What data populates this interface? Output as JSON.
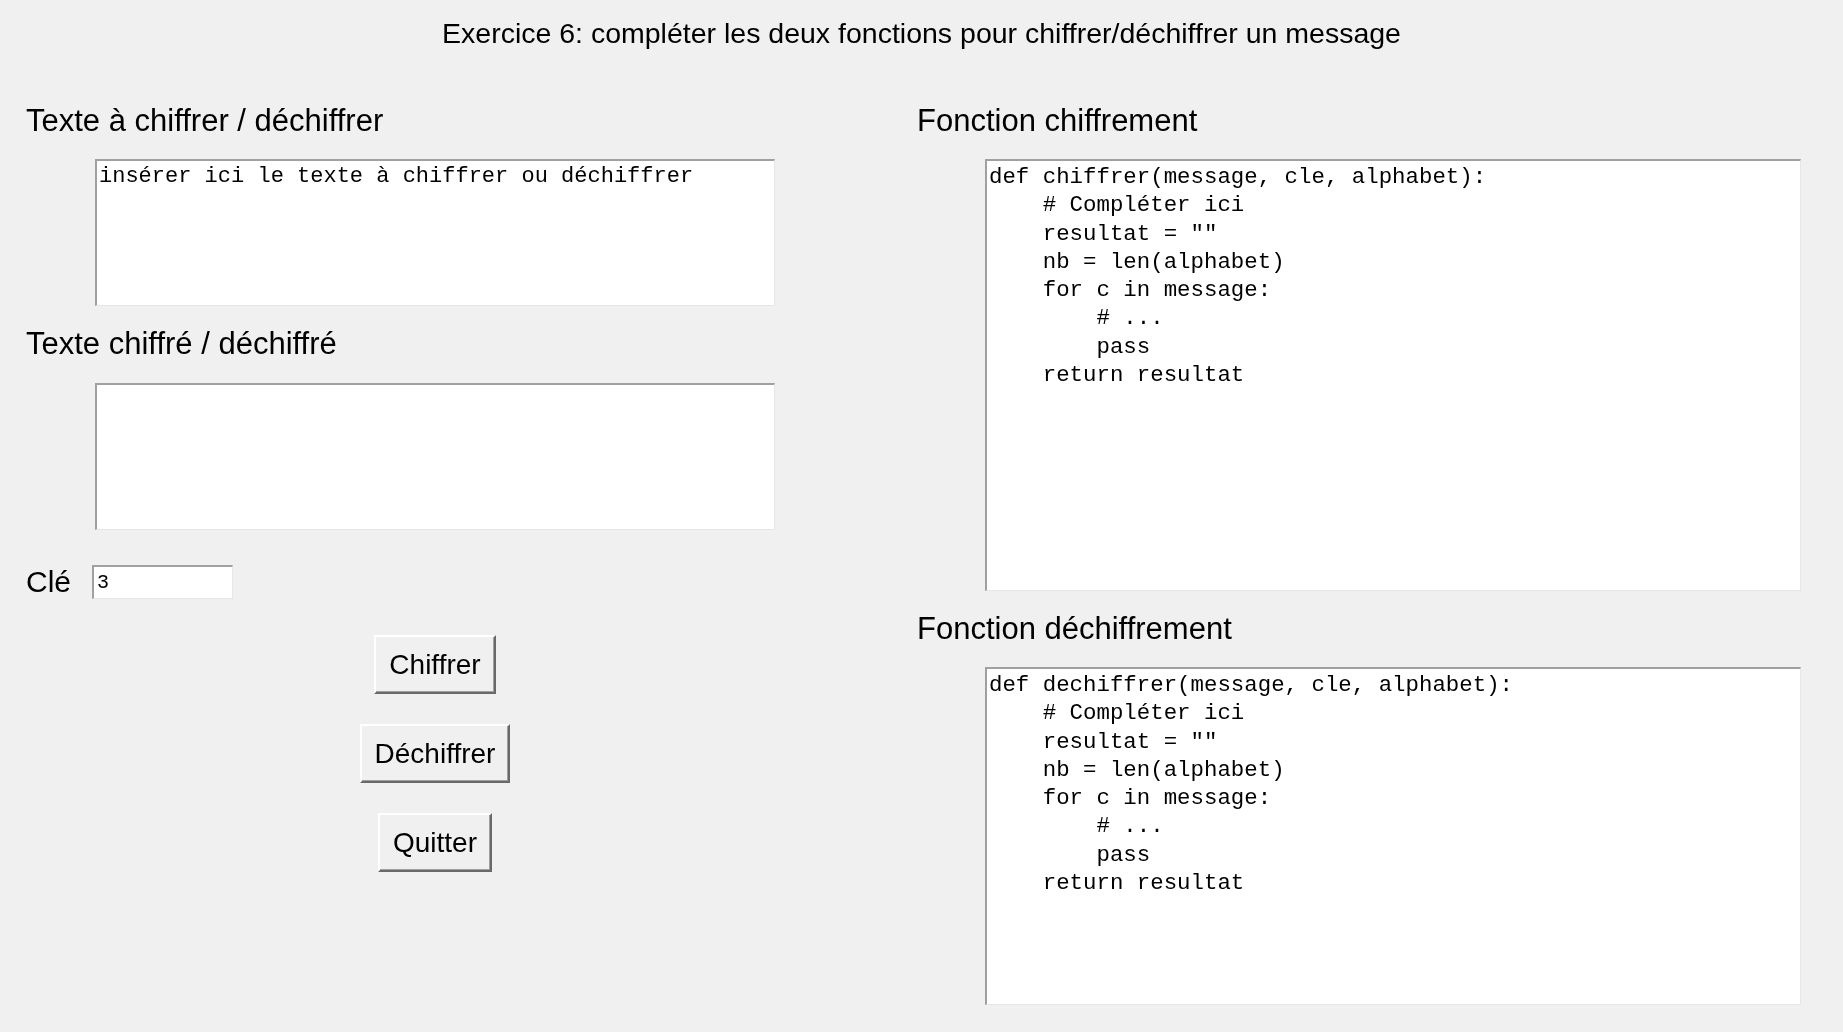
{
  "title": "Exercice 6: compléter les deux fonctions pour chiffrer/déchiffrer un message",
  "input_panel": {
    "heading": "Texte à chiffrer / déchiffrer",
    "value": "insérer ici le texte à chiffrer ou déchiffrer"
  },
  "output_panel": {
    "heading": "Texte chiffré / déchiffré"
  },
  "key_field": {
    "label": "Clé",
    "value": "3"
  },
  "buttons": [
    "Chiffrer",
    "Déchiffrer",
    "Quitter"
  ],
  "code_panels": [
    {
      "heading": "Fonction chiffrement",
      "lines": [
        "def chiffrer(message, cle, alphabet):",
        "    # Compléter ici",
        "    resultat = \"\"",
        "    nb = len(alphabet)",
        "    for c in message:",
        "        # ...",
        "        pass",
        "    return resultat"
      ]
    },
    {
      "heading": "Fonction déchiffrement",
      "lines": [
        "def dechiffrer(message, cle, alphabet):",
        "    # Compléter ici",
        "    resultat = \"\"",
        "    nb = len(alphabet)",
        "    for c in message:",
        "        # ...",
        "        pass",
        "    return resultat"
      ]
    }
  ]
}
